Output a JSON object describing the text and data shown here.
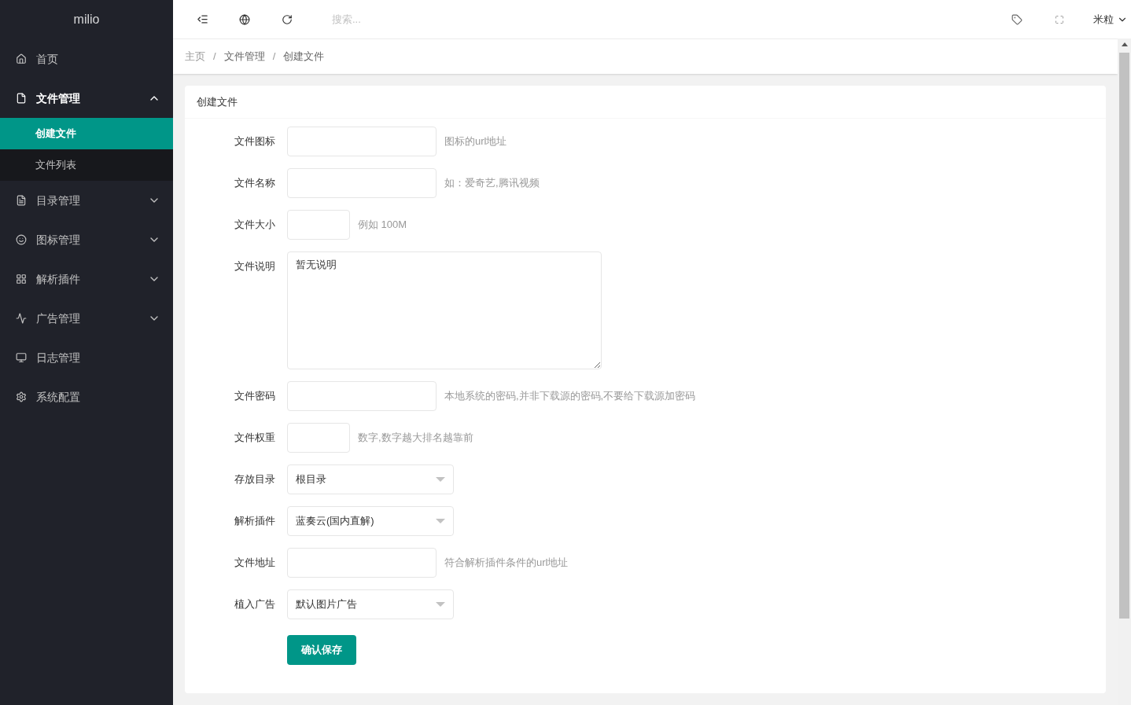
{
  "brand": "milio",
  "sidebar": {
    "items": [
      {
        "label": "首页",
        "expandable": false,
        "expanded": false,
        "selected": false
      },
      {
        "label": "文件管理",
        "expandable": true,
        "expanded": true,
        "selected": false,
        "children": [
          {
            "label": "创建文件",
            "selected": true
          },
          {
            "label": "文件列表",
            "selected": false
          }
        ]
      },
      {
        "label": "目录管理",
        "expandable": true,
        "expanded": false,
        "selected": false
      },
      {
        "label": "图标管理",
        "expandable": true,
        "expanded": false,
        "selected": false
      },
      {
        "label": "解析插件",
        "expandable": true,
        "expanded": false,
        "selected": false
      },
      {
        "label": "广告管理",
        "expandable": true,
        "expanded": false,
        "selected": false
      },
      {
        "label": "日志管理",
        "expandable": false,
        "expanded": false,
        "selected": false
      },
      {
        "label": "系统配置",
        "expandable": false,
        "expanded": false,
        "selected": false
      }
    ]
  },
  "header": {
    "search": {
      "placeholder": "搜索..."
    },
    "user": "米粒"
  },
  "breadcrumb": {
    "separator": "/",
    "items": [
      "主页",
      "文件管理",
      "创建文件"
    ]
  },
  "card": {
    "title": "创建文件",
    "fields": [
      {
        "kind": "input",
        "label": "文件图标",
        "hint": "图标的url地址"
      },
      {
        "kind": "input",
        "label": "文件名称",
        "hint": "如：爱奇艺,腾讯视频"
      },
      {
        "kind": "shortinput",
        "label": "文件大小",
        "hint": "例如 100M"
      },
      {
        "kind": "textarea",
        "label": "文件说明",
        "value": "暂无说明"
      },
      {
        "kind": "input",
        "label": "文件密码",
        "hint": "本地系统的密码,并非下载源的密码,不要给下载源加密码"
      },
      {
        "kind": "shortinput",
        "label": "文件权重",
        "hint": "数字,数字越大排名越靠前"
      },
      {
        "kind": "select",
        "label": "存放目录",
        "value": "根目录"
      },
      {
        "kind": "select",
        "label": "解析插件",
        "value": "蓝奏云(国内直解)"
      },
      {
        "kind": "input",
        "label": "文件地址",
        "hint": "符合解析插件条件的url地址"
      },
      {
        "kind": "select",
        "label": "植入广告",
        "value": "默认图片广告"
      }
    ],
    "submit": "确认保存"
  }
}
